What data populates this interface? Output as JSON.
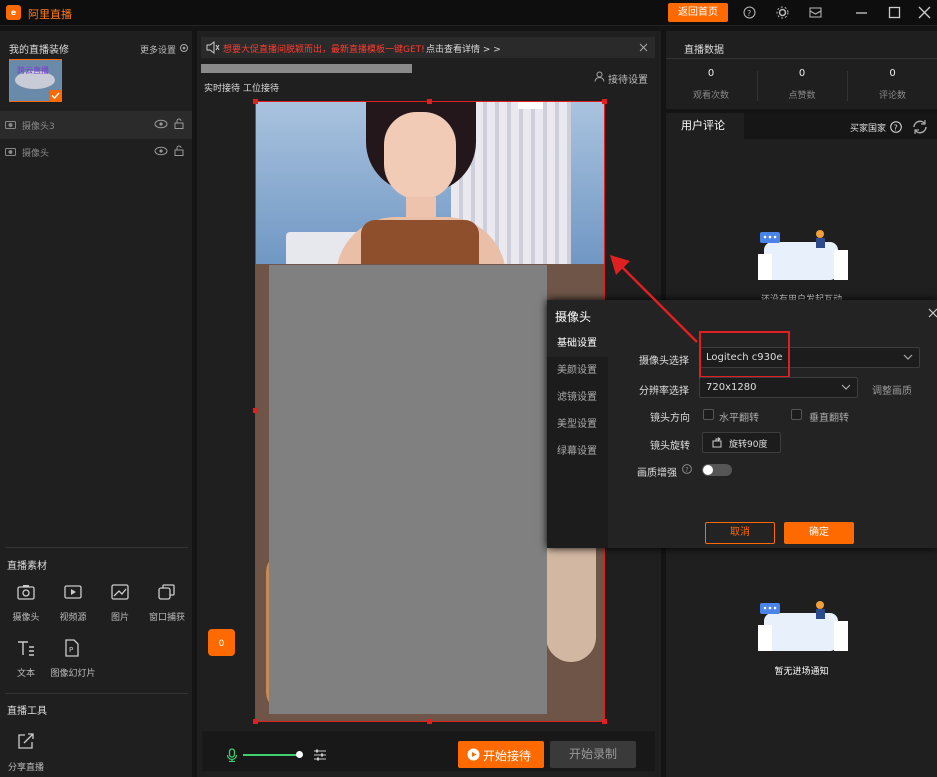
{
  "titlebar": {
    "logo": "e",
    "app_title": "阿里直播",
    "home_button": "返回首页"
  },
  "left": {
    "my_decor": "我的直播装修",
    "more_settings": "更多设置",
    "thumb_text": "跨云直播",
    "layers": [
      {
        "label": "摄像头3"
      },
      {
        "label": "摄像头"
      }
    ],
    "materials_title": "直播素材",
    "tools": [
      {
        "label": "摄像头"
      },
      {
        "label": "视频源"
      },
      {
        "label": "图片"
      },
      {
        "label": "窗口捕获"
      },
      {
        "label": "文本"
      },
      {
        "label": "图像幻灯片"
      }
    ],
    "tools_title": "直播工具",
    "share": "分享直播"
  },
  "center": {
    "notice": "想要大促直播间脱颖而出，最新直播模板一键GET!",
    "notice_link": "点击查看详情 > >",
    "tab_realtime": "实时接待",
    "tab_station": "工位接待",
    "reception_settings": "接待设置",
    "badge_count": "0",
    "start_reception": "开始接待",
    "start_record": "开始录制"
  },
  "stats": {
    "title": "直播数据",
    "items": [
      {
        "value": "0",
        "label": "观看次数"
      },
      {
        "value": "0",
        "label": "点赞数"
      },
      {
        "value": "0",
        "label": "评论数"
      }
    ]
  },
  "comments": {
    "tab_user": "用户评论",
    "buyer_country": "买家国家",
    "empty_interact": "还没有用户发起互动",
    "empty_entry": "暂无进场通知"
  },
  "dialog": {
    "title": "摄像头",
    "tabs": [
      {
        "label": "基础设置"
      },
      {
        "label": "美颜设置"
      },
      {
        "label": "滤镜设置"
      },
      {
        "label": "美型设置"
      },
      {
        "label": "绿幕设置"
      }
    ],
    "camera_label": "摄像头选择",
    "camera_value": "Logitech c930e",
    "resolution_label": "分辨率选择",
    "resolution_value": "720x1280",
    "adjust_quality": "调整画质",
    "direction_label": "镜头方向",
    "flip_h": "水平翻转",
    "flip_v": "垂直翻转",
    "rotate_label": "镜头旋转",
    "rotate_button": "旋转90度",
    "enhance_label": "画质增强",
    "cancel": "取消",
    "confirm": "确定"
  },
  "colors": {
    "accent": "#ff6a00",
    "highlight": "#e02020",
    "panel": "#1f1f1f"
  }
}
